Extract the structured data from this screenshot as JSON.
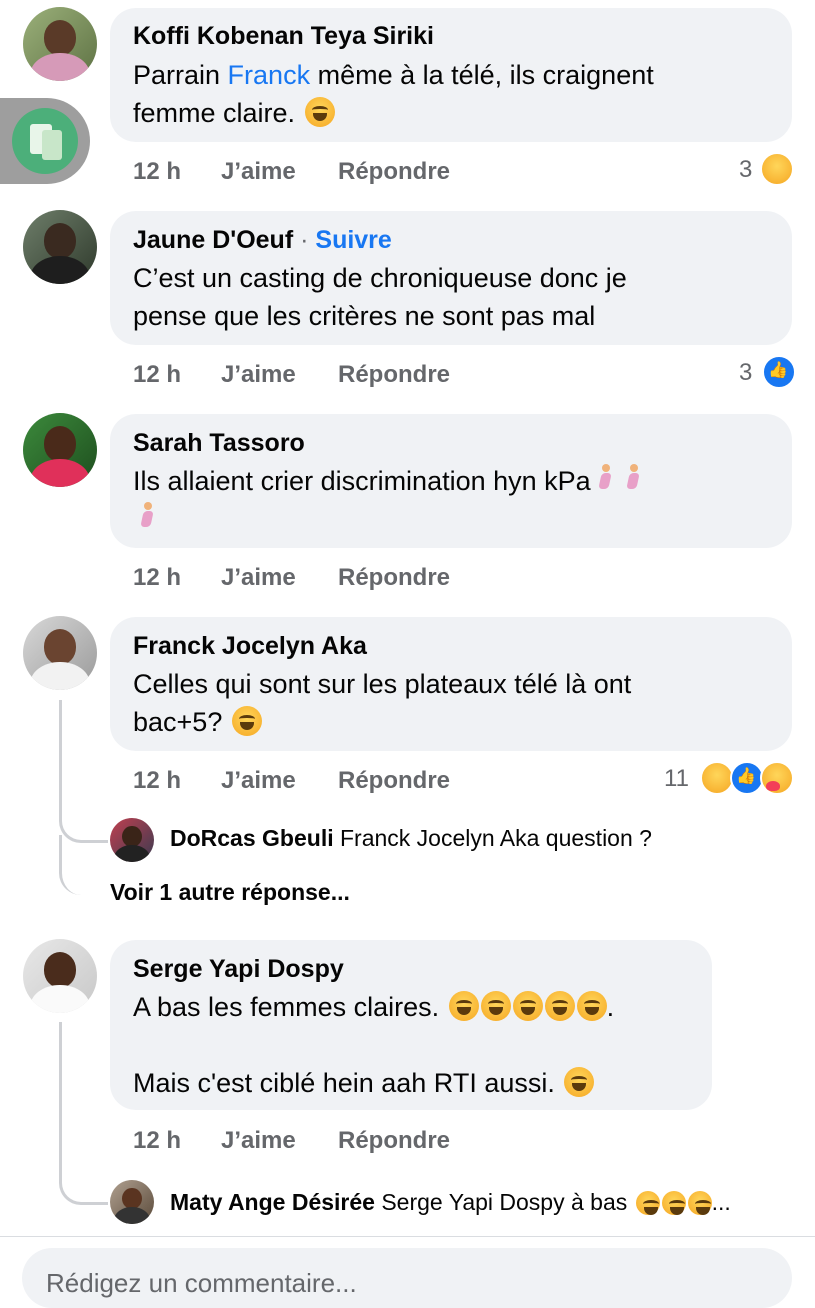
{
  "comments": [
    {
      "name": "Koffi Kobenan Teya Siriki",
      "text_line1_a": "Parrain ",
      "text_line1_link": "Franck",
      "text_line1_b": " même à la télé, ils craignent",
      "text_line2": "femme claire.",
      "time": "12 h",
      "like": "J’aime",
      "reply": "Répondre",
      "reaction_count": "3"
    },
    {
      "name": "Jaune D'Oeuf",
      "separator": "·",
      "follow": "Suivre",
      "text_line1": "C’est un casting de chroniqueuse donc je",
      "text_line2": "pense que les critères ne sont pas mal",
      "time": "12 h",
      "like": "J’aime",
      "reply": "Répondre",
      "reaction_count": "3"
    },
    {
      "name": "Sarah Tassoro",
      "text_line1": "Ils allaient crier discrimination hyn kPa",
      "time": "12 h",
      "like": "J’aime",
      "reply": "Répondre"
    },
    {
      "name": "Franck Jocelyn Aka",
      "text_line1": "Celles qui sont sur les plateaux télé là ont",
      "text_line2": "bac+5?",
      "time": "12 h",
      "like": "J’aime",
      "reply": "Répondre",
      "reaction_count": "11",
      "reply_preview": {
        "name": "DoRcas Gbeuli",
        "text": "Franck Jocelyn Aka question ?"
      },
      "more_replies": "Voir 1 autre réponse..."
    },
    {
      "name": "Serge Yapi Dospy",
      "text_line1": "A bas les femmes claires.",
      "text_line1_end": ".",
      "text_line2": "Mais c'est ciblé hein aah RTI aussi.",
      "time": "12 h",
      "like": "J’aime",
      "reply": "Répondre",
      "reply_preview": {
        "name": "Maty Ange Désirée",
        "text": "Serge Yapi Dospy à bas",
        "ellipsis": "..."
      }
    }
  ],
  "composer": {
    "placeholder": "Rédigez un commentaire..."
  },
  "colors": {
    "link": "#1877f2",
    "bubble": "#f0f2f5",
    "meta": "#65676b"
  },
  "icons": {
    "overlay": "voice-to-text-icon"
  }
}
